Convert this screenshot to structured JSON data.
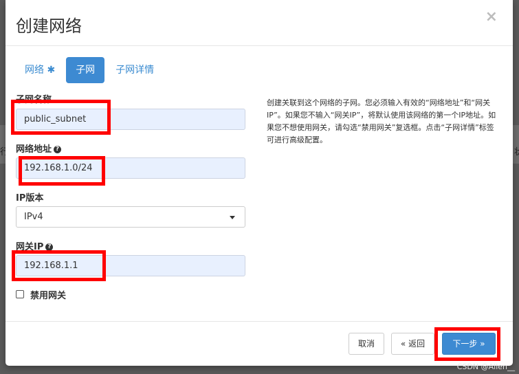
{
  "dialog": {
    "title": "创建网络",
    "close_symbol": "×"
  },
  "tabs": [
    {
      "label": "网络",
      "required_mark": "✱"
    },
    {
      "label": "子网"
    },
    {
      "label": "子网详情"
    }
  ],
  "form": {
    "subnet_name": {
      "label": "子网名称",
      "value": "public_subnet"
    },
    "network_address": {
      "label": "网络地址",
      "help_symbol": "?",
      "value": "192.168.1.0/24"
    },
    "ip_version": {
      "label": "IP版本",
      "selected": "IPv4"
    },
    "gateway_ip": {
      "label": "网关IP",
      "help_symbol": "?",
      "value": "192.168.1.1"
    },
    "disable_gateway": {
      "label": "禁用网关",
      "checked": false
    }
  },
  "help_text": "创建关联到这个网络的子网。您必须输入有效的“网络地址”和“网关IP”。如果您不输入“网关IP”，将默认使用该网络的第一个IP地址。如果您不想使用网关，请勾选“禁用网关”复选框。点击“子网详情”标签可进行高级配置。",
  "footer": {
    "cancel_label": "取消",
    "back_label": "« 返回",
    "next_label": "下一步 »"
  },
  "background": {
    "left_text": "行",
    "right_text": "状"
  },
  "watermark": "CSDN @Allen__",
  "colors": {
    "primary": "#3d8ad2",
    "input_bg": "#e8f0fe",
    "highlight": "#ff0000"
  }
}
